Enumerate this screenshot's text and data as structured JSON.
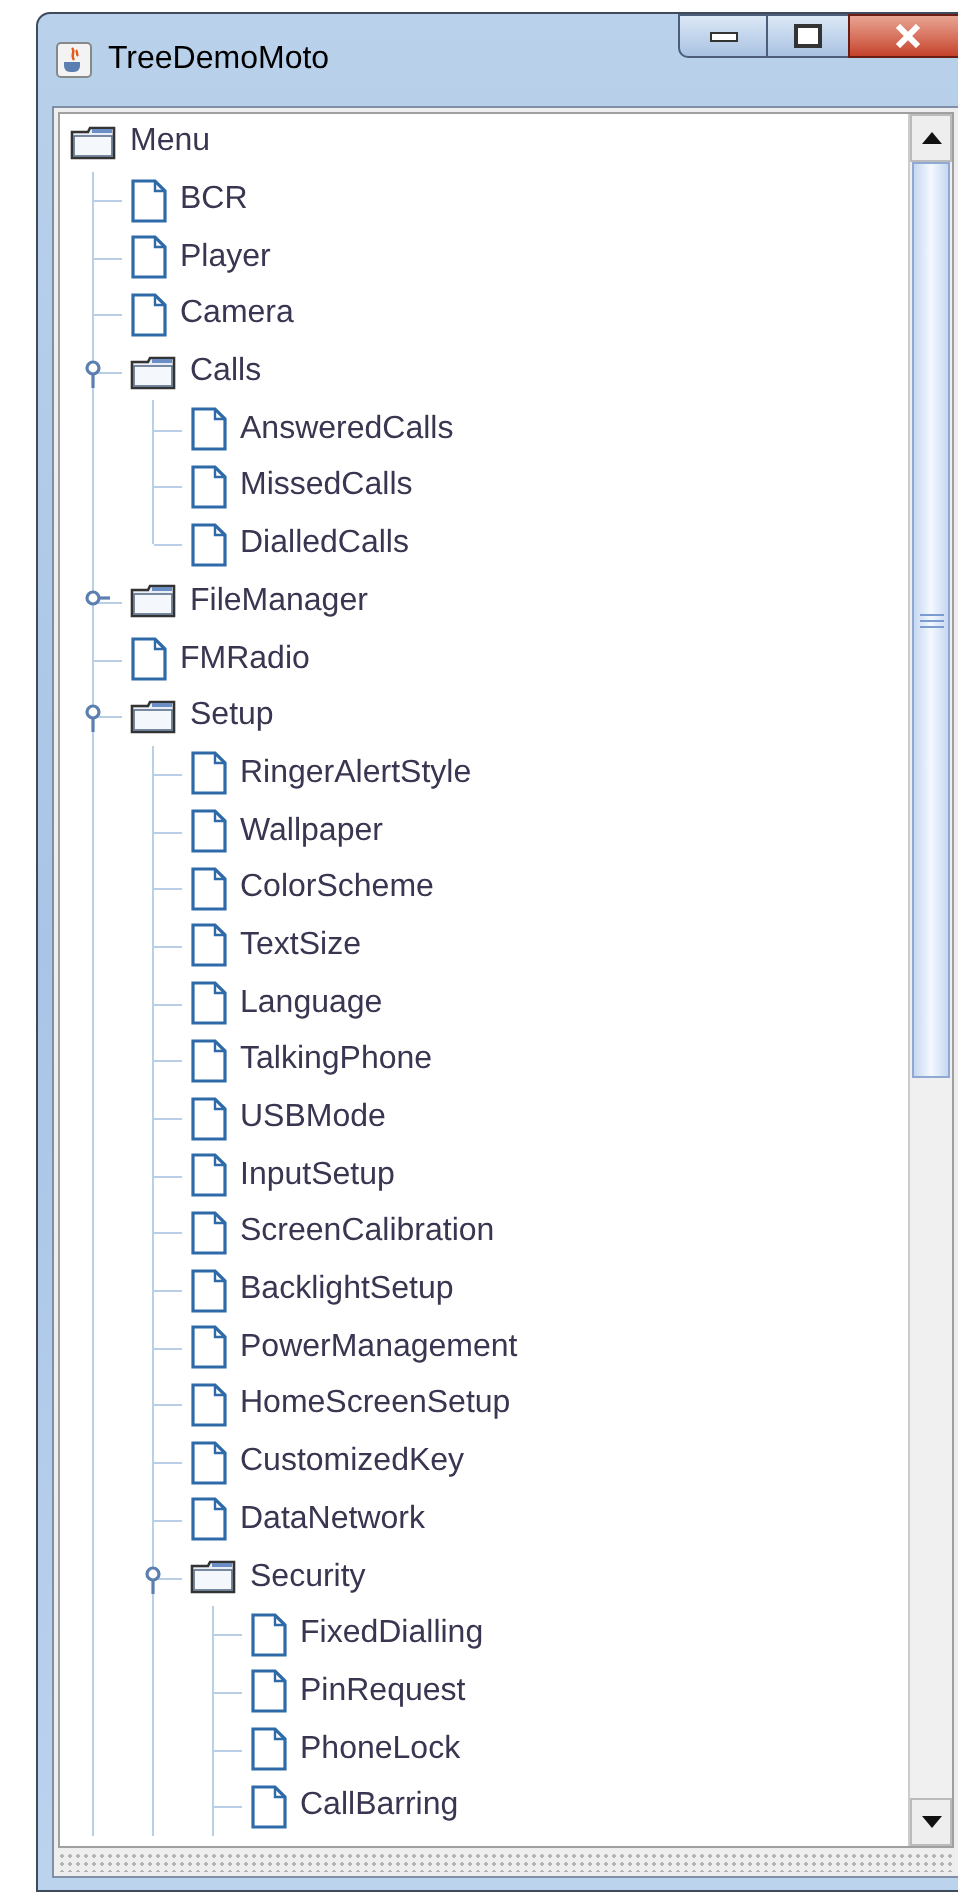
{
  "window": {
    "title": "TreeDemoMoto"
  },
  "tree": {
    "label": "Menu",
    "kind": "folder",
    "children": [
      {
        "label": "BCR",
        "kind": "leaf"
      },
      {
        "label": "Player",
        "kind": "leaf"
      },
      {
        "label": "Camera",
        "kind": "leaf"
      },
      {
        "label": "Calls",
        "kind": "folder",
        "expanded": true,
        "children": [
          {
            "label": "AnsweredCalls",
            "kind": "leaf"
          },
          {
            "label": "MissedCalls",
            "kind": "leaf"
          },
          {
            "label": "DialledCalls",
            "kind": "leaf"
          }
        ]
      },
      {
        "label": "FileManager",
        "kind": "folder",
        "expanded": false
      },
      {
        "label": "FMRadio",
        "kind": "leaf"
      },
      {
        "label": "Setup",
        "kind": "folder",
        "expanded": true,
        "children": [
          {
            "label": "RingerAlertStyle",
            "kind": "leaf"
          },
          {
            "label": "Wallpaper",
            "kind": "leaf"
          },
          {
            "label": "ColorScheme",
            "kind": "leaf"
          },
          {
            "label": "TextSize",
            "kind": "leaf"
          },
          {
            "label": "Language",
            "kind": "leaf"
          },
          {
            "label": "TalkingPhone",
            "kind": "leaf"
          },
          {
            "label": "USBMode",
            "kind": "leaf"
          },
          {
            "label": "InputSetup",
            "kind": "leaf"
          },
          {
            "label": "ScreenCalibration",
            "kind": "leaf"
          },
          {
            "label": "BacklightSetup",
            "kind": "leaf"
          },
          {
            "label": "PowerManagement",
            "kind": "leaf"
          },
          {
            "label": "HomeScreenSetup",
            "kind": "leaf"
          },
          {
            "label": "CustomizedKey",
            "kind": "leaf"
          },
          {
            "label": "DataNetwork",
            "kind": "leaf"
          },
          {
            "label": "Security",
            "kind": "folder",
            "expanded": true,
            "children": [
              {
                "label": "FixedDialling",
                "kind": "leaf"
              },
              {
                "label": "PinRequest",
                "kind": "leaf"
              },
              {
                "label": "PhoneLock",
                "kind": "leaf"
              },
              {
                "label": "CallBarring",
                "kind": "leaf"
              }
            ]
          }
        ]
      }
    ]
  }
}
